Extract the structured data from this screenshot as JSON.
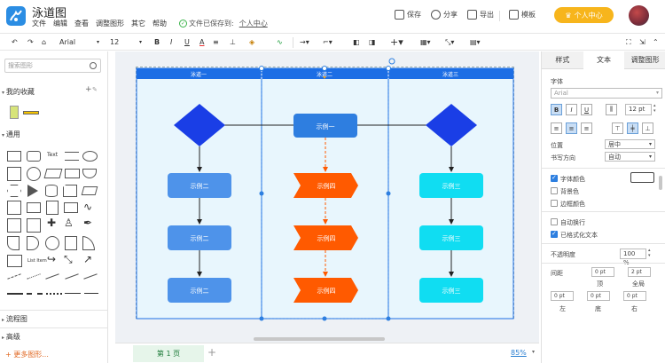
{
  "app": {
    "title": "泳道图",
    "menu": [
      "文件",
      "编辑",
      "查看",
      "调整图形",
      "其它",
      "帮助"
    ],
    "save_status": "文件已保存到:",
    "save_location": "个人中心"
  },
  "header": {
    "save": "保存",
    "share": "分享",
    "export": "导出",
    "template": "模板",
    "personal_center": "个人中心"
  },
  "toolbar": {
    "font_family": "Arial",
    "font_size": "12"
  },
  "left": {
    "search_placeholder": "搜索图形",
    "favorites": "我的收藏",
    "general": "通用",
    "flowchart": "流程图",
    "advanced": "高级",
    "more_shapes": "+ 更多图形...",
    "text_shape": "Text",
    "list_item": "List Item"
  },
  "diagram": {
    "lanes": [
      "泳道一",
      "泳道二",
      "泳道三"
    ],
    "nodes": {
      "top_mid": "示例一",
      "left": [
        "示例二",
        "示例二",
        "示例二"
      ],
      "mid": [
        "示例四",
        "示例四",
        "示例四"
      ],
      "right": [
        "示例三",
        "示例三",
        "示例三"
      ]
    },
    "colors": {
      "diamond": "#1a3ee6",
      "blue_box": "#4e93ea",
      "top_box": "#2e7ee0",
      "orange": "#ff5a00",
      "cyan": "#10ddf2",
      "lane_header": "#1c6ee5"
    }
  },
  "bottom": {
    "page_tab": "第 1 页",
    "zoom": "85%"
  },
  "right": {
    "tabs": [
      "样式",
      "文本",
      "调整图形"
    ],
    "font_label": "字体",
    "font_value": "Arial",
    "font_size": "12 pt",
    "position_label": "位置",
    "position_value": "居中",
    "direction_label": "书写方向",
    "direction_value": "自动",
    "font_color": "字体颜色",
    "background_color": "背景色",
    "border_color": "边框颜色",
    "auto_wrap": "自动换行",
    "formatted_text": "已格式化文本",
    "opacity_label": "不透明度",
    "opacity_value": "100 %",
    "spacing_label": "间距",
    "top_label": "顶",
    "global_label": "全局",
    "left_label": "左",
    "bottom_label": "底",
    "right_label": "右",
    "spacing_top": "0 pt",
    "spacing_global": "2 pt",
    "spacing_left": "0 pt",
    "spacing_bottom": "0 pt",
    "spacing_right": "0 pt"
  }
}
